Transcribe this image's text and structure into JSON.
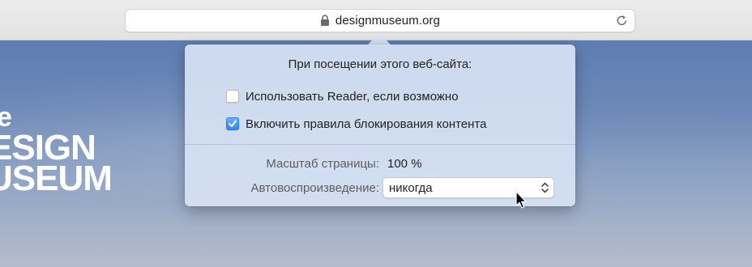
{
  "toolbar": {
    "url": "designmuseum.org",
    "lock_icon": "lock-icon",
    "reload_icon": "reload-icon"
  },
  "page": {
    "logo_lines": [
      "e",
      "ESIGN",
      "USEUM"
    ]
  },
  "popover": {
    "title": "При посещении этого веб-сайта:",
    "options": [
      {
        "label": "Использовать Reader, если возможно",
        "checked": false
      },
      {
        "label": "Включить правила блокирования контента",
        "checked": true
      }
    ],
    "zoom_label": "Масштаб страницы:",
    "zoom_value": "100 %",
    "autoplay_label": "Автовоспроизведение:",
    "autoplay_value": "никогда"
  },
  "colors": {
    "accent": "#2d86f6",
    "popover_bg": "#d6e1f3",
    "page_bg_top": "#5d7db2",
    "page_bg_bottom": "#b4bccc"
  }
}
